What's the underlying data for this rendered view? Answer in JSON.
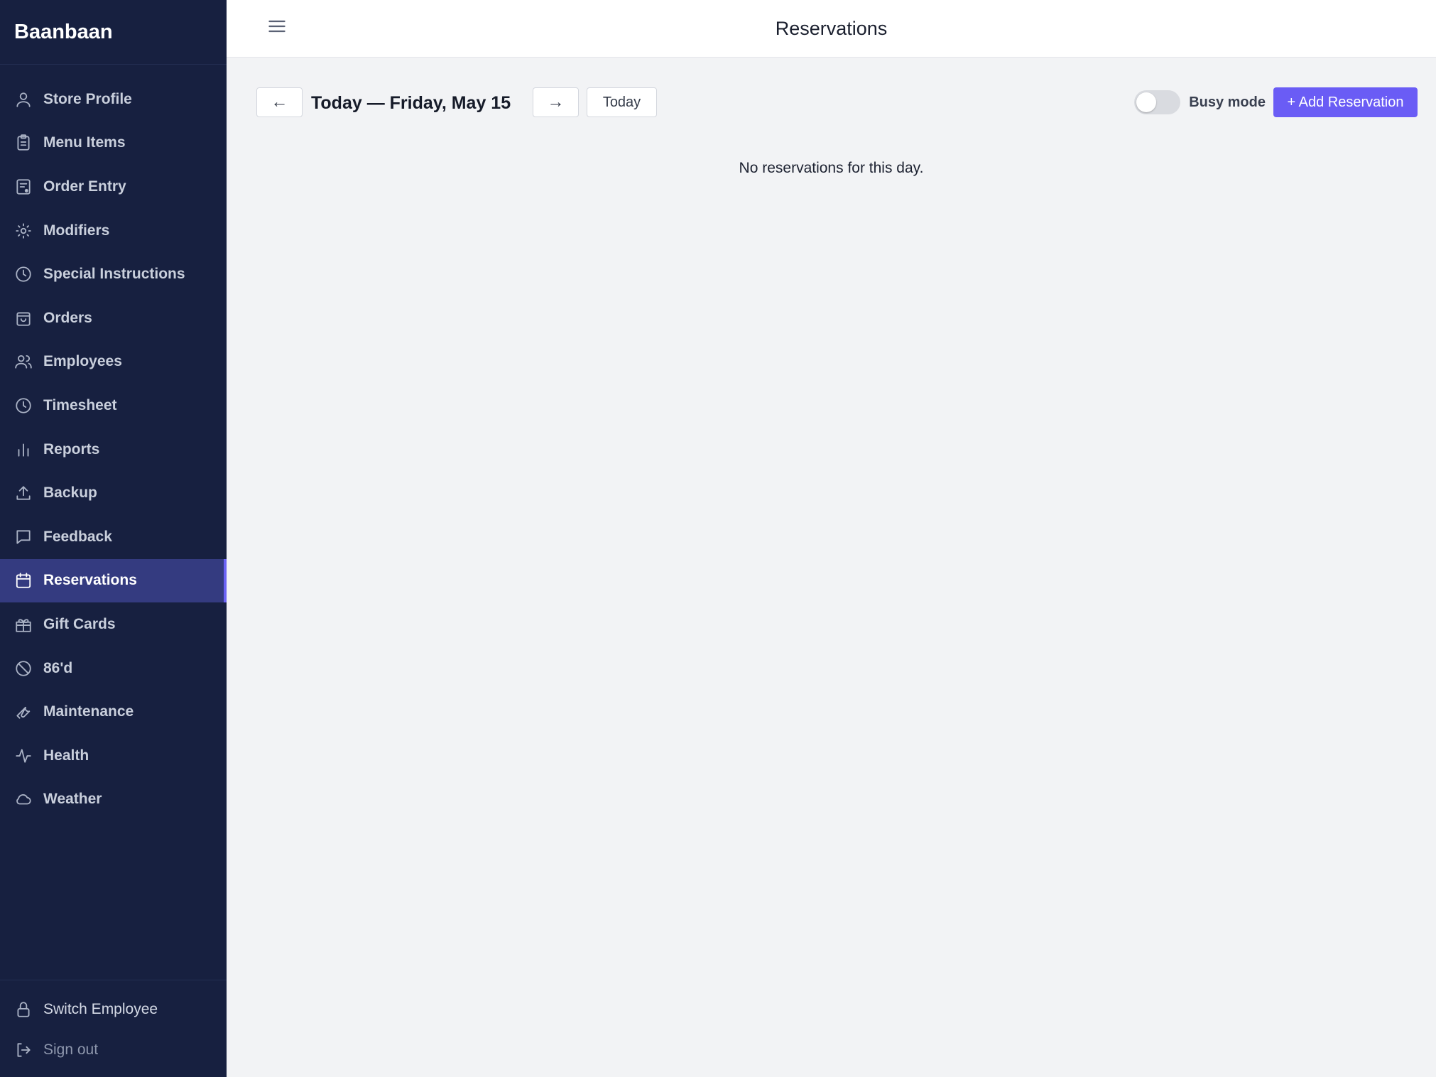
{
  "app": {
    "name": "Baanbaan"
  },
  "sidebar": {
    "items": [
      {
        "label": "Store Profile",
        "icon": "user-icon"
      },
      {
        "label": "Menu Items",
        "icon": "clipboard-icon"
      },
      {
        "label": "Order Entry",
        "icon": "order-entry-icon"
      },
      {
        "label": "Modifiers",
        "icon": "sun-icon"
      },
      {
        "label": "Special Instructions",
        "icon": "clock-icon"
      },
      {
        "label": "Orders",
        "icon": "bag-icon"
      },
      {
        "label": "Employees",
        "icon": "users-icon"
      },
      {
        "label": "Timesheet",
        "icon": "clock-icon"
      },
      {
        "label": "Reports",
        "icon": "bar-chart-icon"
      },
      {
        "label": "Backup",
        "icon": "upload-icon"
      },
      {
        "label": "Feedback",
        "icon": "message-icon"
      },
      {
        "label": "Reservations",
        "icon": "calendar-icon",
        "active": true
      },
      {
        "label": "Gift Cards",
        "icon": "gift-icon"
      },
      {
        "label": "86'd",
        "icon": "ban-icon"
      },
      {
        "label": "Maintenance",
        "icon": "wrench-icon"
      },
      {
        "label": "Health",
        "icon": "activity-icon"
      },
      {
        "label": "Weather",
        "icon": "cloud-icon"
      }
    ],
    "footer": {
      "switch_employee": "Switch Employee",
      "sign_out": "Sign out"
    }
  },
  "header": {
    "title": "Reservations"
  },
  "toolbar": {
    "prev": "←",
    "date_label": "Today — Friday, May 15",
    "next": "→",
    "today": "Today",
    "busy_mode_label": "Busy mode",
    "busy_mode_on": false,
    "add_reservation": "+ Add Reservation"
  },
  "content": {
    "empty_message": "No reservations for this day."
  },
  "colors": {
    "sidebar_bg": "#172040",
    "active_bg": "#343b80",
    "accent": "#6a5cf5"
  }
}
